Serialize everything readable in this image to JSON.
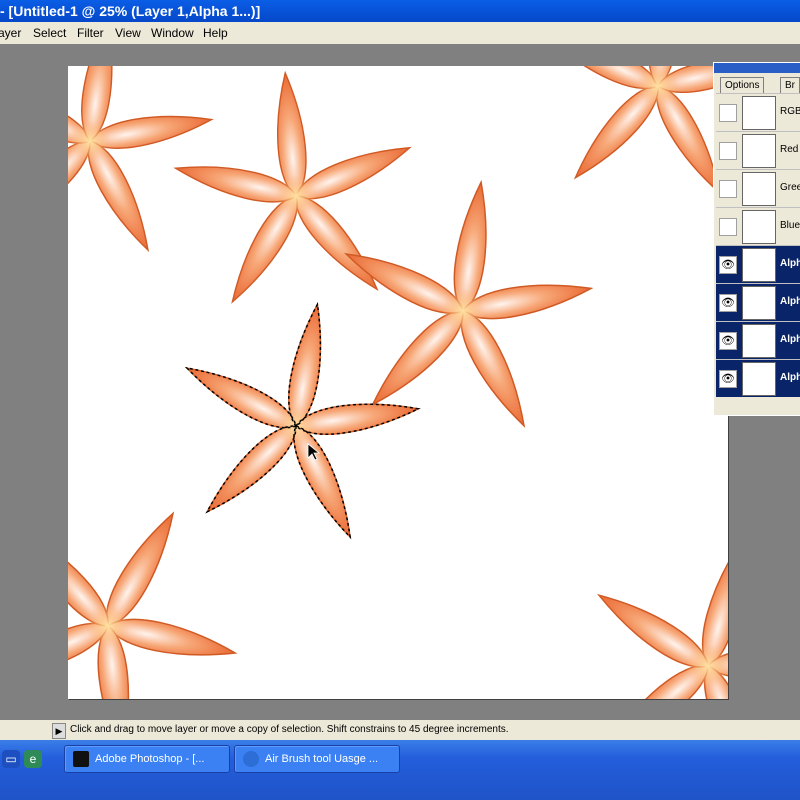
{
  "window": {
    "title": "- [Untitled-1 @ 25% (Layer 1,Alpha 1...)]"
  },
  "menu": [
    {
      "label": "ayer",
      "accel": ""
    },
    {
      "label": "Select",
      "accel": "S"
    },
    {
      "label": "Filter",
      "accel": "i"
    },
    {
      "label": "View",
      "accel": "V"
    },
    {
      "label": "Window",
      "accel": "W"
    },
    {
      "label": "Help",
      "accel": "H"
    }
  ],
  "channels_panel": {
    "tabs": [
      "Options",
      "Br"
    ],
    "channels": [
      {
        "label": "RGB",
        "visible": false,
        "selected": false
      },
      {
        "label": "Red",
        "visible": false,
        "selected": false
      },
      {
        "label": "Gree",
        "visible": false,
        "selected": false
      },
      {
        "label": "Blue",
        "visible": false,
        "selected": false
      },
      {
        "label": "Alph",
        "visible": true,
        "selected": true
      },
      {
        "label": "Alph",
        "visible": true,
        "selected": true
      },
      {
        "label": "Alph",
        "visible": true,
        "selected": true
      },
      {
        "label": "Alph",
        "visible": true,
        "selected": true
      }
    ]
  },
  "status": {
    "message": "Click and drag to move layer or move a copy of selection. Shift constrains to 45 degree increments."
  },
  "taskbar": {
    "tasks": [
      {
        "label": "Adobe Photoshop - [...",
        "icon": "photoshop-icon"
      },
      {
        "label": "Air Brush tool Uasge ...",
        "icon": "browser-icon"
      }
    ]
  },
  "colors": {
    "flower": "#ef7a3a",
    "flower_center": "#ffd9a0",
    "selection": "#0a246a",
    "taskbar": "#245edb"
  }
}
